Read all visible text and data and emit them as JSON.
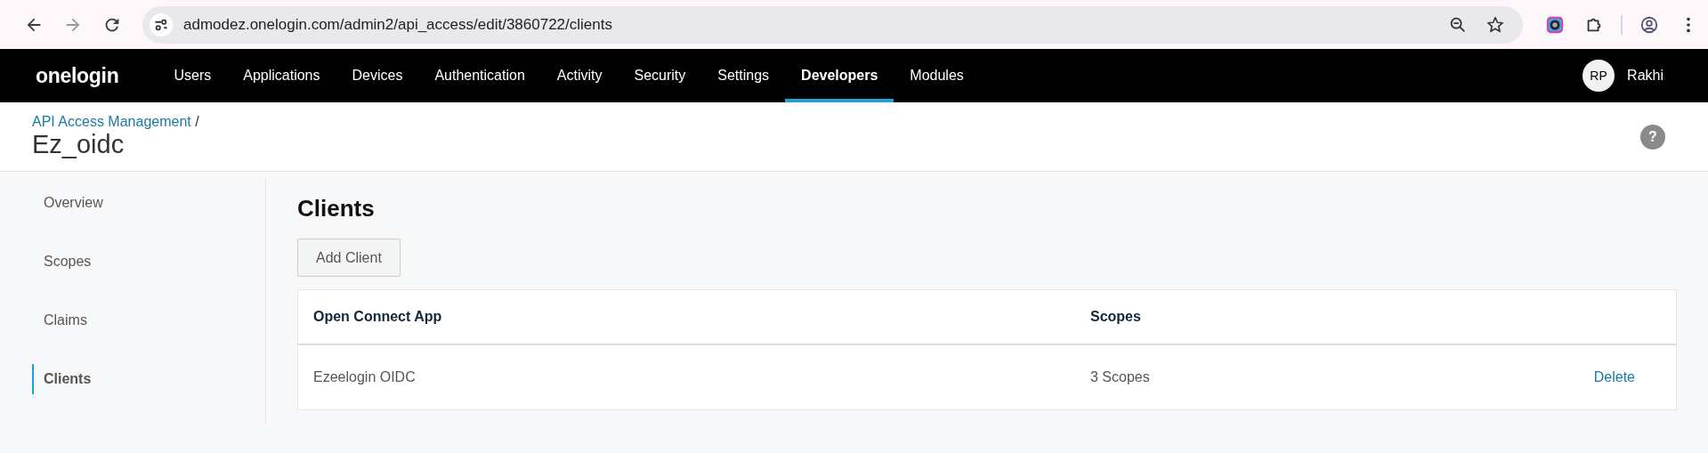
{
  "browser": {
    "url": "admodez.onelogin.com/admin2/api_access/edit/3860722/clients"
  },
  "nav": {
    "logo": "onelogin",
    "items": [
      {
        "label": "Users",
        "selected": false
      },
      {
        "label": "Applications",
        "selected": false
      },
      {
        "label": "Devices",
        "selected": false
      },
      {
        "label": "Authentication",
        "selected": false
      },
      {
        "label": "Activity",
        "selected": false
      },
      {
        "label": "Security",
        "selected": false
      },
      {
        "label": "Settings",
        "selected": false
      },
      {
        "label": "Developers",
        "selected": true
      },
      {
        "label": "Modules",
        "selected": false
      }
    ],
    "user": {
      "initials": "RP",
      "name": "Rakhi"
    }
  },
  "header": {
    "breadcrumb": "API Access Management",
    "separator": "/",
    "title": "Ez_oidc",
    "help": "?"
  },
  "sidebar": {
    "items": [
      {
        "label": "Overview",
        "selected": false
      },
      {
        "label": "Scopes",
        "selected": false
      },
      {
        "label": "Claims",
        "selected": false
      },
      {
        "label": "Clients",
        "selected": true
      }
    ]
  },
  "main": {
    "title": "Clients",
    "add_button": "Add Client",
    "table": {
      "columns": [
        "Open Connect App",
        "Scopes"
      ],
      "rows": [
        {
          "app": "Ezeelogin OIDC",
          "scopes": "3 Scopes",
          "action": "Delete"
        }
      ]
    }
  }
}
